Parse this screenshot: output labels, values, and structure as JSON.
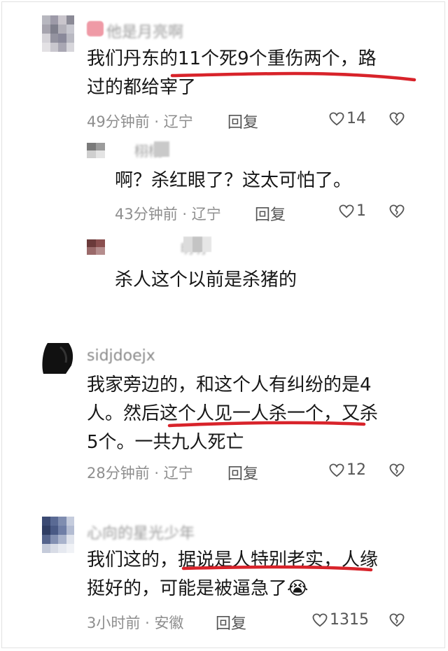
{
  "comments": [
    {
      "name": "他是月亮啊",
      "text_lines": [
        "我们丹东的11个死9个重伤两个，路",
        "过的都给宰了"
      ],
      "time": "49分钟前",
      "location": "辽宁",
      "reply_label": "回复",
      "likes": "14"
    },
    {
      "name": "栩栩",
      "text_lines": [
        "啊？杀红眼了？这太可怕了。"
      ],
      "time": "43分钟前",
      "location": "辽宁",
      "reply_label": "回复",
      "likes": "1"
    },
    {
      "name": "明明",
      "text_lines": [
        "杀人这个以前是杀猪的"
      ]
    },
    {
      "name": "sidjdoejx",
      "text_lines": [
        "我家旁边的，和这个人有纠纷的是4",
        "人。然后这个人见一人杀一个，又杀",
        "5个。一共九人死亡"
      ],
      "time": "28分钟前",
      "location": "辽宁",
      "reply_label": "回复",
      "likes": "12"
    },
    {
      "name": "心向的星光少年",
      "text_lines": [
        "我们这的，据说是人特别老实，人缘",
        "挺好的，可能是被逼急了😭"
      ],
      "time": "3小时前",
      "location": "安徽",
      "reply_label": "回复",
      "likes": "1315"
    }
  ],
  "meta_separator": "·",
  "icons": {
    "like": "heart-outline-icon",
    "dislike": "broken-heart-icon",
    "badge": "pink-badge-icon"
  },
  "colors": {
    "underline": "#d8232a",
    "text": "#161616",
    "meta": "#8e8e8e"
  }
}
